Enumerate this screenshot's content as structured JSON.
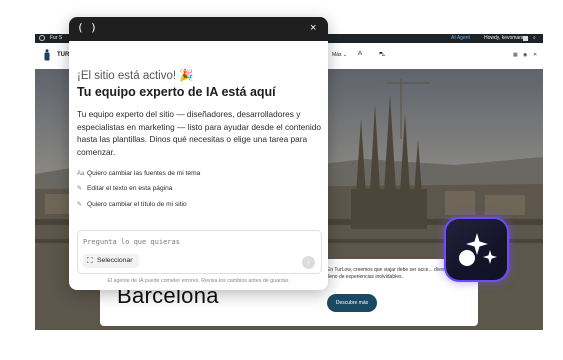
{
  "wp_admin_bar": {
    "site_label": "Fur S",
    "ai_agent": "AI Agent",
    "howdy": "Howdy, kevomann",
    "search_icon": "search-icon"
  },
  "site_header": {
    "site_name": "TUR",
    "nav_more": "Más",
    "nav_a": "A",
    "nav_cart": "cart-icon"
  },
  "hero": {
    "city": "Barcelona",
    "description": "En TurLow, creemos que viajar debe ser acce... divertido y lleno de experiencias inolvidables.",
    "cta": "Descubre más"
  },
  "chat_panel": {
    "brand": "( )",
    "close": "×",
    "greeting": "¡El sitio está activo! 🎉",
    "headline": "Tu equipo experto de IA está aquí",
    "intro": "Tu equipo experto del sitio — diseñadores, desarrolladores y especialistas en marketing — listo para ayudar desde el contenido hasta las plantillas. Dinos qué necesitas o elige una tarea para comenzar.",
    "suggestions": [
      {
        "icon": "font-size-icon",
        "glyph": "Aa",
        "label": "Quiero cambiar las fuentes de mi tema"
      },
      {
        "icon": "pencil-icon",
        "glyph": "✎",
        "label": "Editar el texto en esta página"
      },
      {
        "icon": "pencil-icon",
        "glyph": "✎",
        "label": "Quiero cambiar el título de mi sitio"
      }
    ],
    "input_placeholder": "Pregunta lo que quieras",
    "select_label": "Seleccionar",
    "send_icon": "↑",
    "disclaimer": "El agente de IA puede cometer errores. Revisa los cambios antes de guardar."
  },
  "colors": {
    "panel_header": "#1f1f1f",
    "cta_bg": "#1a4a63",
    "app_icon_glow": "#6b4cff"
  }
}
